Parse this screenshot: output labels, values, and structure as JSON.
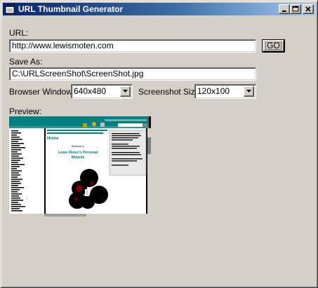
{
  "window": {
    "title": "URL Thumbnail Generator",
    "minimize_label": "_",
    "maximize_icon": "maximize-icon",
    "close_label": "✕"
  },
  "form": {
    "url_label": "URL:",
    "url_value": "http://www.lewismoten.com",
    "go_label": "GO",
    "save_as_label": "Save As:",
    "save_as_value": "C:\\URLScreenShot\\ScreenShot.jpg",
    "browser_window_label": "Browser Window:",
    "browser_window_value": "640x480",
    "screenshot_size_label": "Screenshot Size:",
    "screenshot_size_value": "120x100",
    "preview_label": "Preview:"
  },
  "preview": {
    "heading": "Home",
    "welcome": "Welcome to",
    "site_title_1": "Lewis Moten's Personal",
    "site_title_2": "Website",
    "accent_color": "#008080",
    "sidebar_color": "#ffffff"
  }
}
